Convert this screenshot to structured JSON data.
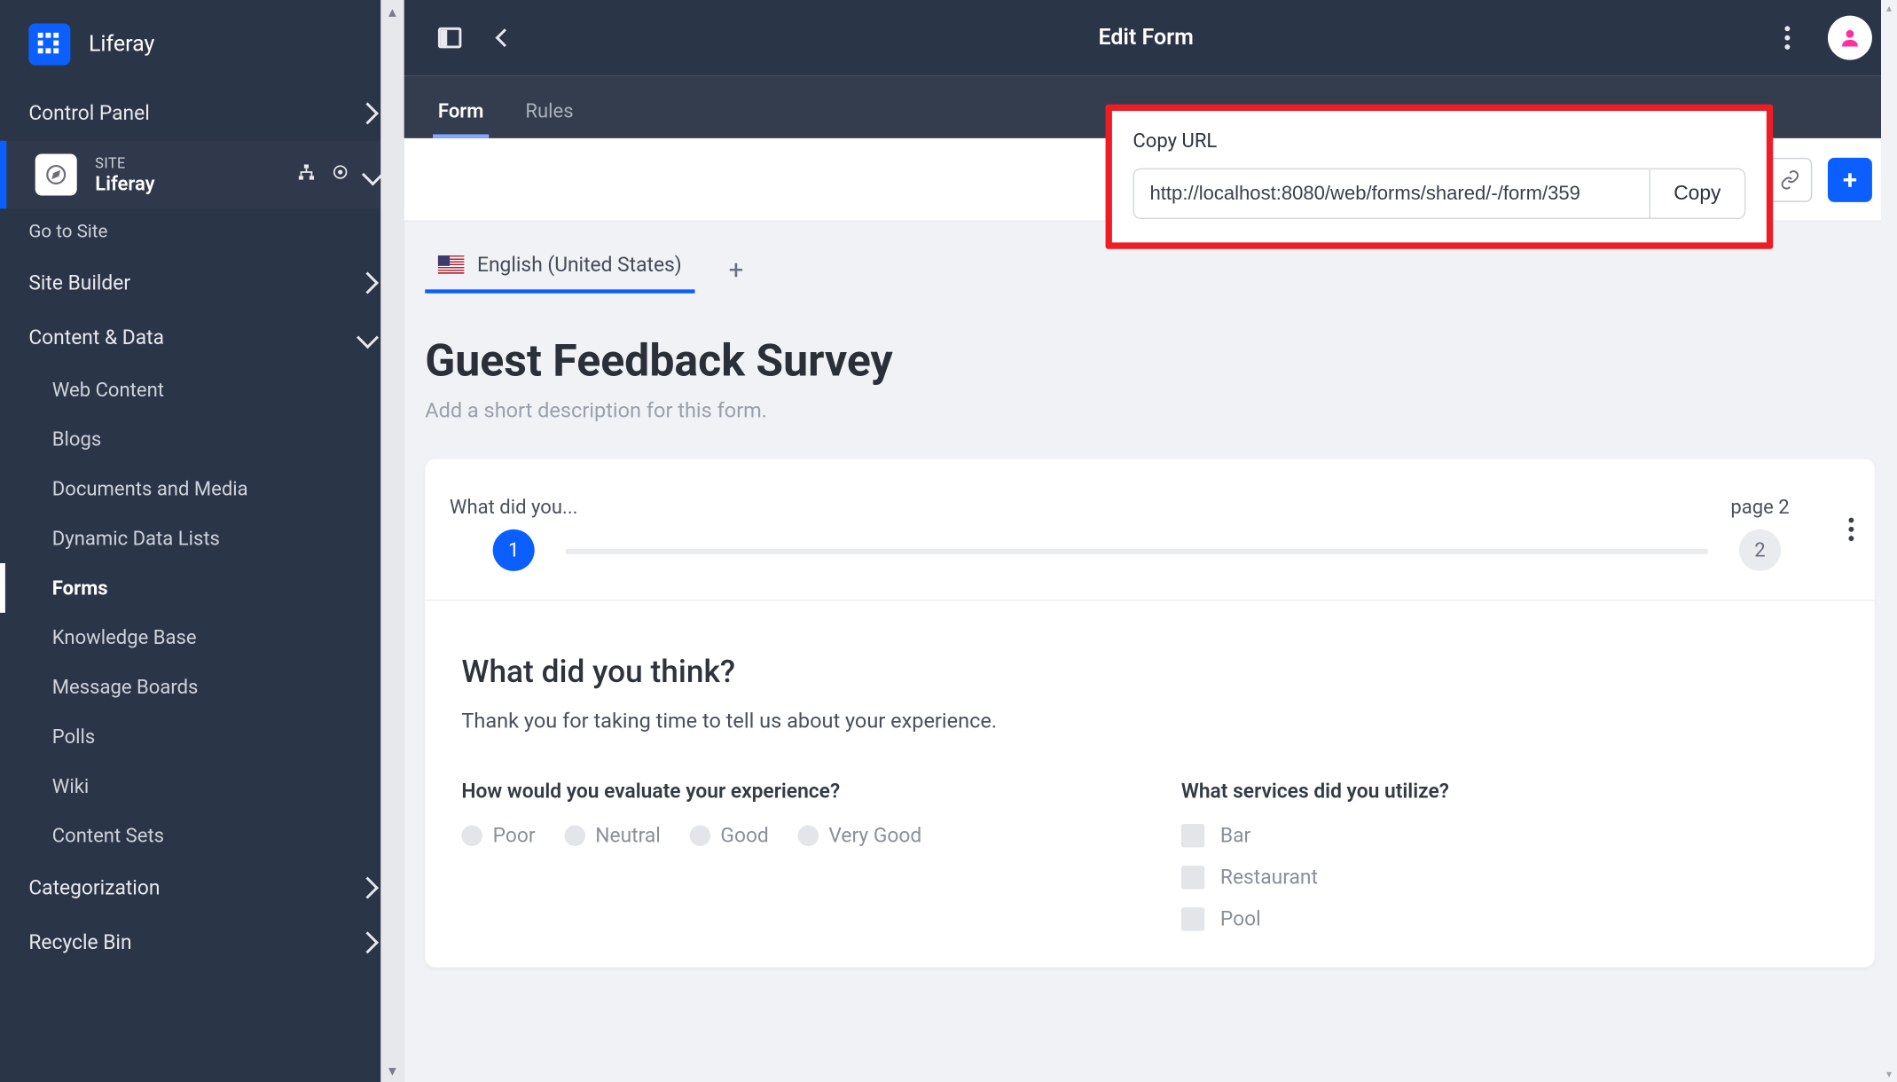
{
  "brand": {
    "name": "Liferay"
  },
  "sidebar": {
    "control_panel": "Control Panel",
    "site_kicker": "SITE",
    "site_name": "Liferay",
    "go_to_site": "Go to Site",
    "site_builder": "Site Builder",
    "content_data": "Content & Data",
    "items": [
      "Web Content",
      "Blogs",
      "Documents and Media",
      "Dynamic Data Lists",
      "Forms",
      "Knowledge Base",
      "Message Boards",
      "Polls",
      "Wiki",
      "Content Sets"
    ],
    "categorization": "Categorization",
    "recycle_bin": "Recycle Bin"
  },
  "topbar": {
    "title": "Edit Form"
  },
  "tabs": {
    "form": "Form",
    "rules": "Rules"
  },
  "popover": {
    "title": "Copy URL",
    "url": "http://localhost:8080/web/forms/shared/-/form/359",
    "copy": "Copy"
  },
  "lang": {
    "label": "English (United States)"
  },
  "form": {
    "title": "Guest Feedback Survey",
    "desc_placeholder": "Add a short description for this form."
  },
  "stepper": {
    "page1_label": "What did you...",
    "page1_num": "1",
    "page2_label": "page 2",
    "page2_num": "2"
  },
  "page": {
    "heading": "What did you think?",
    "sub": "Thank you for taking time to tell us about your experience.",
    "q1": {
      "label": "How would you evaluate your experience?",
      "options": [
        "Poor",
        "Neutral",
        "Good",
        "Very Good"
      ]
    },
    "q2": {
      "label": "What services did you utilize?",
      "options": [
        "Bar",
        "Restaurant",
        "Pool"
      ]
    }
  }
}
